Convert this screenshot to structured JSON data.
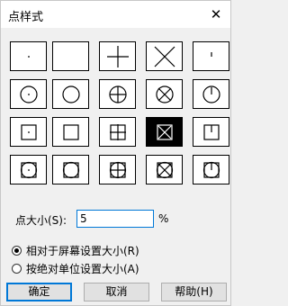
{
  "window": {
    "title": "点样式",
    "close_label": "✕"
  },
  "styles": {
    "selected_index": 13,
    "items": [
      {
        "frame": "none",
        "mark": "dot",
        "icon": "point-style-dot-icon"
      },
      {
        "frame": "none",
        "mark": "none",
        "icon": "point-style-blank-icon"
      },
      {
        "frame": "none",
        "mark": "plus",
        "icon": "point-style-plus-icon"
      },
      {
        "frame": "none",
        "mark": "cross",
        "icon": "point-style-cross-icon"
      },
      {
        "frame": "none",
        "mark": "tick",
        "icon": "point-style-tick-icon"
      },
      {
        "frame": "circle",
        "mark": "dot",
        "icon": "point-style-circle-dot-icon"
      },
      {
        "frame": "circle",
        "mark": "none",
        "icon": "point-style-circle-icon"
      },
      {
        "frame": "circle",
        "mark": "plus",
        "icon": "point-style-circle-plus-icon"
      },
      {
        "frame": "circle",
        "mark": "cross",
        "icon": "point-style-circle-cross-icon"
      },
      {
        "frame": "circle",
        "mark": "tick",
        "icon": "point-style-circle-tick-icon"
      },
      {
        "frame": "square",
        "mark": "dot",
        "icon": "point-style-square-dot-icon"
      },
      {
        "frame": "square",
        "mark": "none",
        "icon": "point-style-square-icon"
      },
      {
        "frame": "square",
        "mark": "plus",
        "icon": "point-style-square-plus-icon"
      },
      {
        "frame": "square",
        "mark": "cross",
        "icon": "point-style-square-cross-icon"
      },
      {
        "frame": "square",
        "mark": "tick",
        "icon": "point-style-square-tick-icon"
      },
      {
        "frame": "both",
        "mark": "dot",
        "icon": "point-style-circle-square-dot-icon"
      },
      {
        "frame": "both",
        "mark": "none",
        "icon": "point-style-circle-square-icon"
      },
      {
        "frame": "both",
        "mark": "plus",
        "icon": "point-style-circle-square-plus-icon"
      },
      {
        "frame": "both",
        "mark": "cross",
        "icon": "point-style-circle-square-cross-icon"
      },
      {
        "frame": "both",
        "mark": "tick",
        "icon": "point-style-circle-square-tick-icon"
      }
    ]
  },
  "size": {
    "label": "点大小(S):",
    "value": "5",
    "unit": "%"
  },
  "mode": {
    "options": [
      {
        "label": "相对于屏幕设置大小(R)",
        "checked": true
      },
      {
        "label": "按绝对单位设置大小(A)",
        "checked": false
      }
    ]
  },
  "buttons": {
    "ok": "确定",
    "cancel": "取消",
    "help": "帮助(H)"
  },
  "colors": {
    "selected_bg": "#000000",
    "focus": "#0078d7",
    "mark": "#000000",
    "selected_mark": "#ffffff"
  }
}
